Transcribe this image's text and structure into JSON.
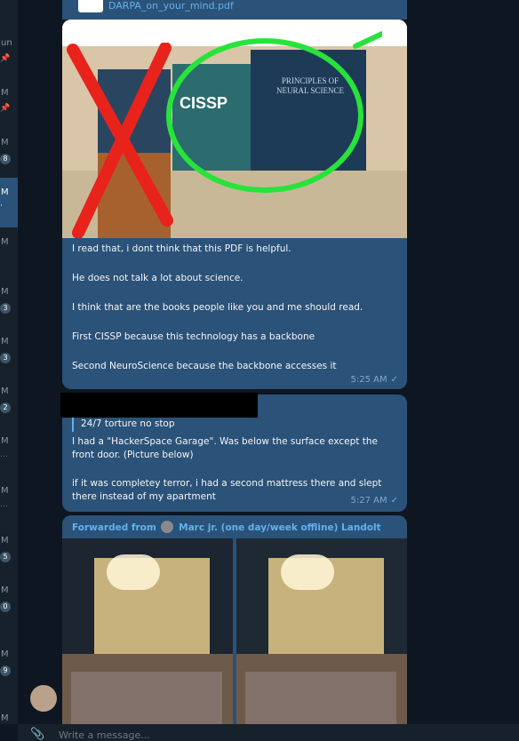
{
  "sidebar": {
    "items": [
      {
        "time": "un",
        "badge": "",
        "pinned": true
      },
      {
        "time": "M",
        "badge": "",
        "pinned": true
      },
      {
        "time": "M",
        "badge": "8",
        "pinned": false
      },
      {
        "time": "M",
        "badge": "",
        "pinned": false,
        "active": true
      },
      {
        "time": "M",
        "badge": "",
        "pinned": false
      },
      {
        "time": "M",
        "badge": "3",
        "pinned": false
      },
      {
        "time": "M",
        "badge": "3",
        "pinned": false
      },
      {
        "time": "M",
        "badge": "2",
        "pinned": false
      },
      {
        "time": "M",
        "badge": "",
        "pinned": false
      },
      {
        "time": "M",
        "badge": "",
        "pinned": false
      },
      {
        "time": "M",
        "badge": "5",
        "pinned": false
      },
      {
        "time": "M",
        "badge": "0",
        "pinned": false
      },
      {
        "time": "M",
        "badge": "9",
        "pinned": false
      },
      {
        "time": "M",
        "badge": "",
        "pinned": false
      }
    ]
  },
  "file_message": {
    "file_name": "DARPA_on_your_mind.pdf",
    "icon": "file-icon"
  },
  "message1": {
    "photo": {
      "cross_out_color": "#e8231c",
      "circle_color": "#27e33a",
      "book2_title": "CISSP",
      "book3_title": "PRINCIPLES OF NEURAL SCIENCE"
    },
    "lines": [
      "I read that, i dont think that this PDF is helpful.",
      "He does not talk a lot about science.",
      "I think that are the books people like you and me should read.",
      "First CISSP because this technology has a backbone",
      "Second NeuroScience because the backbone accesses it"
    ],
    "time": "5:25 AM"
  },
  "message2": {
    "reply_quote": "24/7 torture no stop",
    "paragraphs": [
      "I had a \"HackerSpace Garage\". Was below the surface except the front door. (Picture below)",
      "if it was completey terror, i had a second mattress there and slept there instead of my apartment"
    ],
    "time": "5:27 AM"
  },
  "message3": {
    "forwarded_prefix": "Forwarded from",
    "forwarded_name": "Marc jr. (one day/week offline) Landolt"
  },
  "compose": {
    "placeholder": "Write a message..."
  },
  "colors": {
    "bubble": "#2b5278",
    "link": "#62b1ef",
    "background": "#0e1621"
  }
}
